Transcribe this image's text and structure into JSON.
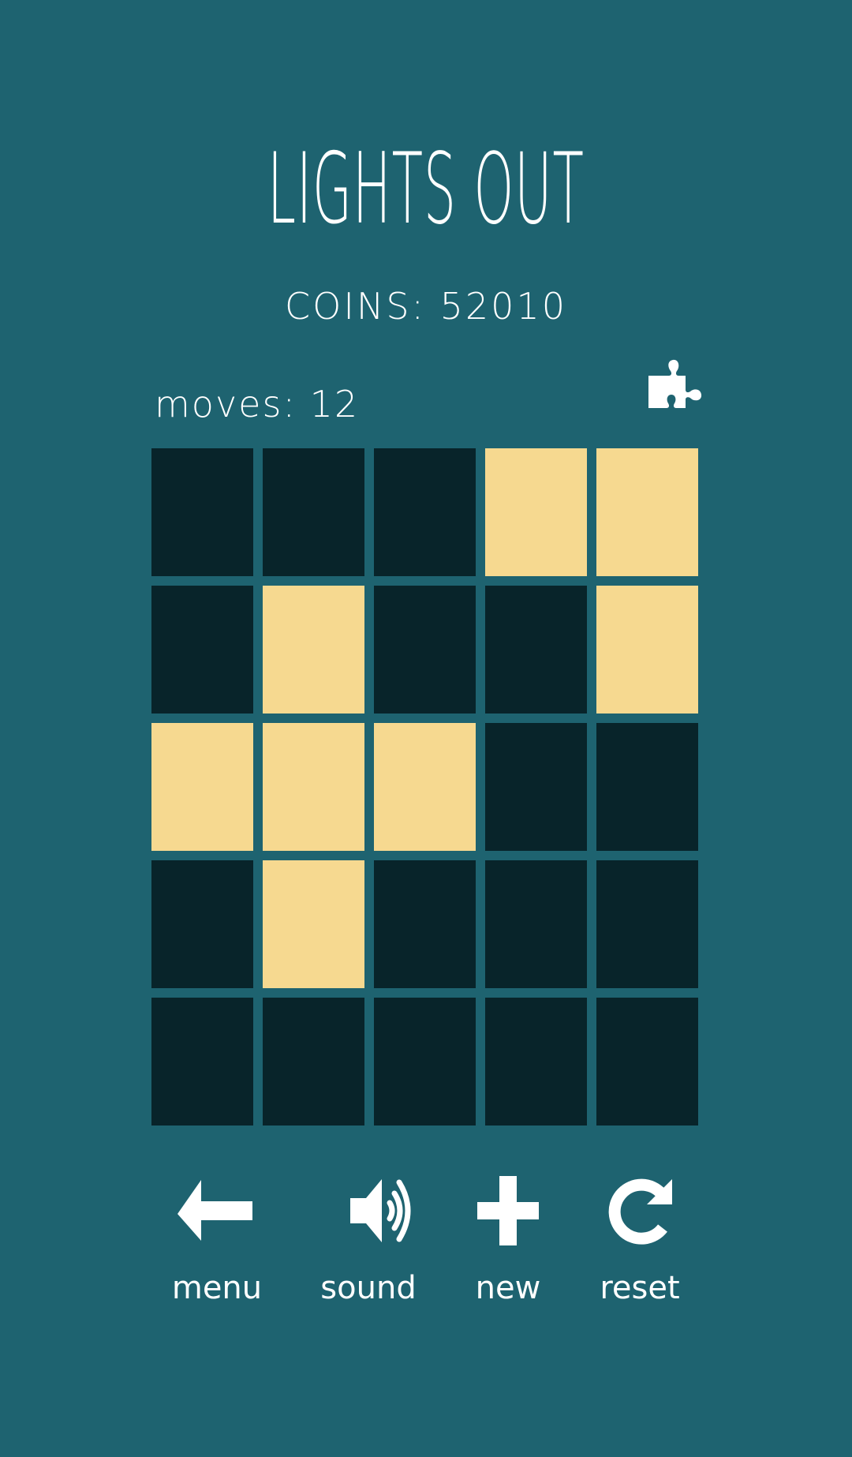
{
  "app": {
    "title": "LIGHTS OUT",
    "coins_label": "COINS: 52010",
    "moves_label": "moves: 12"
  },
  "colors": {
    "background": "#1e6370",
    "light_on": "#f6d990",
    "light_off": "#08242a",
    "text": "#ffffff"
  },
  "hint_button": {
    "icon": "puzzle-piece-icon"
  },
  "board": {
    "rows": 5,
    "cols": 5,
    "cells": [
      [
        0,
        0,
        0,
        1,
        1
      ],
      [
        0,
        1,
        0,
        0,
        1
      ],
      [
        1,
        1,
        1,
        0,
        0
      ],
      [
        0,
        1,
        0,
        0,
        0
      ],
      [
        0,
        0,
        0,
        0,
        0
      ]
    ]
  },
  "controls": [
    {
      "id": "menu",
      "label": "menu",
      "icon": "arrow-left-icon"
    },
    {
      "id": "sound",
      "label": "sound",
      "icon": "speaker-icon"
    },
    {
      "id": "new",
      "label": "new",
      "icon": "plus-icon"
    },
    {
      "id": "reset",
      "label": "reset",
      "icon": "redo-icon"
    }
  ]
}
